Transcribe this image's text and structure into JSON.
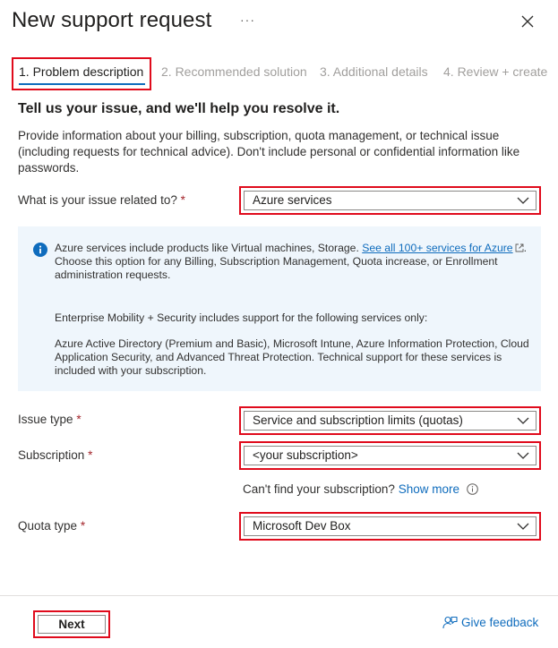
{
  "header": {
    "title": "New support request",
    "more_label": "···"
  },
  "tabs": [
    {
      "label": "1. Problem description"
    },
    {
      "label": "2. Recommended solution"
    },
    {
      "label": "3. Additional details"
    },
    {
      "label": "4. Review + create"
    }
  ],
  "main": {
    "heading": "Tell us your issue, and we'll help you resolve it.",
    "description": "Provide information about your billing, subscription, quota management, or technical issue (including requests for technical advice). Don't include personal or confidential information like passwords."
  },
  "form": {
    "required_marker": "*",
    "issue_related": {
      "label": "What is your issue related to?",
      "value": "Azure services"
    },
    "issue_type": {
      "label": "Issue type",
      "value": "Service and subscription limits (quotas)"
    },
    "subscription": {
      "label": "Subscription",
      "value": "<your subscription>"
    },
    "quota_type": {
      "label": "Quota type",
      "value": "Microsoft Dev Box"
    }
  },
  "info_box": {
    "p1_text": "Azure services include products like Virtual machines, Storage.",
    "p1_link": "See all 100+ services for Azure",
    "p1_after_link": ".",
    "p1_rest": "Choose this option for any Billing, Subscription Management, Quota increase, or Enrollment administration requests.",
    "p2": "Enterprise Mobility + Security includes support for the following services only:",
    "p3": "Azure Active Directory (Premium and Basic), Microsoft Intune, Azure Information Protection, Cloud Application Security, and Advanced Threat Protection. Technical support for these services is included with your subscription."
  },
  "subscription_help": {
    "text": "Can't find your subscription?",
    "link": "Show more"
  },
  "footer": {
    "next_label": "Next",
    "feedback_label": "Give feedback"
  },
  "colors": {
    "accent": "#0f6cbd",
    "highlight_border": "#e00b1c",
    "info_background": "#eff6fc",
    "required": "#a4262c"
  },
  "icons": [
    "more-icon",
    "close-icon",
    "info-icon",
    "external-link-icon",
    "chevron-down-icon",
    "feedback-icon"
  ]
}
